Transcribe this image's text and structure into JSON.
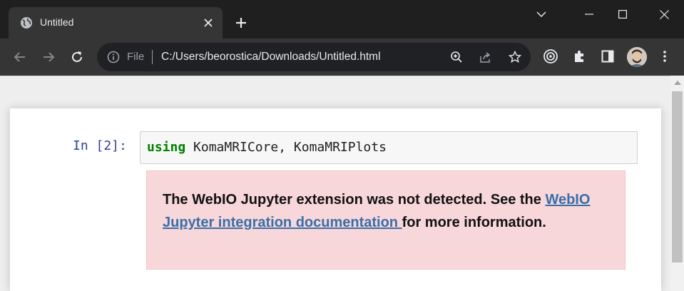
{
  "browser": {
    "tab": {
      "title": "Untitled"
    },
    "address_bar": {
      "scheme_label": "File",
      "url": "C:/Users/beorostica/Downloads/Untitled.html"
    },
    "icons": {
      "favicon": "globe-icon",
      "close": "close-icon",
      "new_tab": "plus-icon",
      "back": "back-arrow-icon",
      "forward": "forward-arrow-icon",
      "reload": "reload-icon",
      "zoom": "zoom-icon",
      "share": "share-icon",
      "bookmark": "star-icon",
      "extension_target": "target-icon",
      "extensions": "puzzle-icon",
      "side_panel": "side-panel-icon",
      "menu": "kebab-menu-icon"
    }
  },
  "notebook": {
    "cell": {
      "prompt": "In [2]:",
      "code_keyword": "using",
      "code_rest": " KomaMRICore, KomaMRIPlots"
    },
    "output": {
      "message_before": "The WebIO Jupyter extension was not detected. See the ",
      "link_text": "WebIO Jupyter integration documentation ",
      "message_after": "for more information."
    }
  },
  "colors": {
    "titlebar": "#1f1f1f",
    "toolbar": "#353535",
    "prompt": "#303f9f",
    "keyword": "#008000",
    "alert_bg": "#f8d7da",
    "link": "#3a6fa8"
  }
}
